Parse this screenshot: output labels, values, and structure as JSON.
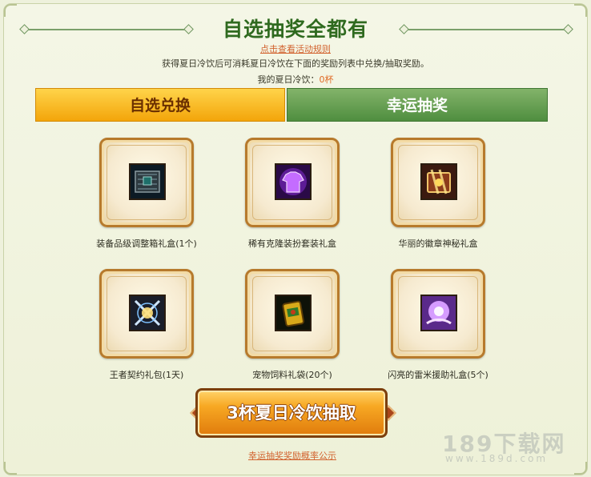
{
  "header": {
    "title": "自选抽奖全都有",
    "rules_link": "点击查看活动规则",
    "description": "获得夏日冷饮后可消耗夏日冷饮在下面的奖励列表中兑换/抽取奖励。",
    "balance_label": "我的夏日冷饮：",
    "balance_value": "0杯"
  },
  "tabs": [
    {
      "label": "自选兑换",
      "active": true
    },
    {
      "label": "幸运抽奖",
      "active": false
    }
  ],
  "rewards": [
    {
      "label": "装备品级调整箱礼盒(1个)",
      "icon": "equipment-grade-box-icon"
    },
    {
      "label": "稀有克隆装扮套装礼盒",
      "icon": "rare-costume-box-icon"
    },
    {
      "label": "华丽的徽章神秘礼盒",
      "icon": "emblem-mystery-box-icon"
    },
    {
      "label": "王者契约礼包(1天)",
      "icon": "king-contract-icon"
    },
    {
      "label": "宠物饲料礼袋(20个)",
      "icon": "pet-food-bag-icon"
    },
    {
      "label": "闪亮的雷米援助礼盒(5个)",
      "icon": "remy-aid-box-icon"
    }
  ],
  "draw_button": "3杯夏日冷饮抽取",
  "probability_link": "幸运抽奖奖励概率公示",
  "watermark": {
    "main": "189下载网",
    "sub": "www.189d.com"
  },
  "colors": {
    "title": "#2f6a1f",
    "link": "#d2622e",
    "active_tab": "#f3a50a",
    "inactive_tab": "#4f8e3f",
    "button": "#e07b0c"
  }
}
